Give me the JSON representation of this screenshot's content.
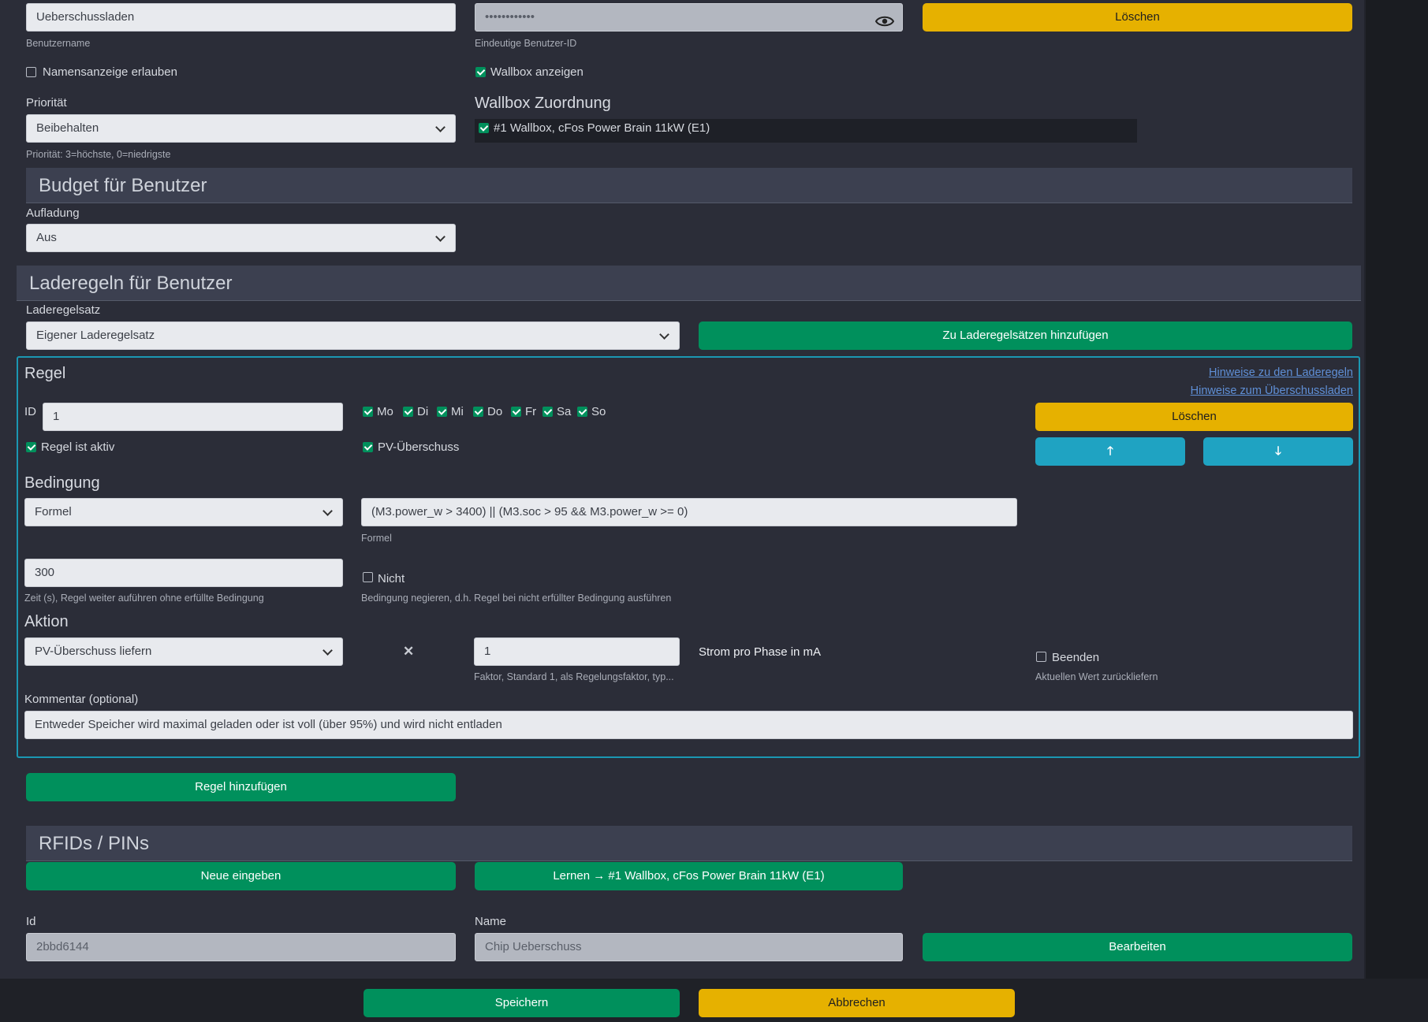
{
  "user": {
    "username_value": "Ueberschussladen",
    "username_caption": "Benutzername",
    "userid_value": "••••••••••••",
    "userid_caption": "Eindeutige Benutzer-ID",
    "delete_label": "Löschen",
    "allow_name_display": {
      "label": "Namensanzeige erlauben",
      "checked": false
    },
    "show_wallbox": {
      "label": "Wallbox anzeigen",
      "checked": true
    },
    "priority_label": "Priorität",
    "priority_value": "Beibehalten",
    "priority_hint": "Priorität: 3=höchste, 0=niedrigste",
    "wallbox_assignment_title": "Wallbox Zuordnung",
    "wallbox_item": {
      "label": "#1 Wallbox, cFos Power Brain 11kW (E1)",
      "checked": true
    }
  },
  "budget": {
    "title": "Budget für Benutzer",
    "charging_label": "Aufladung",
    "charging_value": "Aus"
  },
  "rules": {
    "title": "Laderegeln für Benutzer",
    "ruleset_label": "Laderegelsatz",
    "ruleset_value": "Eigener Laderegelsatz",
    "add_to_rulesets_label": "Zu Laderegelsätzen hinzufügen",
    "rule": {
      "title": "Regel",
      "link_rules_help": "Hinweise zu den Laderegeln",
      "link_surplus_help": "Hinweise zum Überschussladen",
      "id_label": "ID",
      "id_value": "1",
      "days": [
        {
          "label": "Mo",
          "checked": true
        },
        {
          "label": "Di",
          "checked": true
        },
        {
          "label": "Mi",
          "checked": true
        },
        {
          "label": "Do",
          "checked": true
        },
        {
          "label": "Fr",
          "checked": true
        },
        {
          "label": "Sa",
          "checked": true
        },
        {
          "label": "So",
          "checked": true
        }
      ],
      "delete_label": "Löschen",
      "active": {
        "label": "Regel ist aktiv",
        "checked": true
      },
      "pv_surplus": {
        "label": "PV-Überschuss",
        "checked": true
      },
      "condition_title": "Bedingung",
      "condition_type": "Formel",
      "formula_value": "(M3.power_w > 3400) || (M3.soc > 95 && M3.power_w >= 0)",
      "formula_caption": "Formel",
      "time_value": "300",
      "time_caption": "Zeit (s), Regel weiter auführen ohne erfüllte Bedingung",
      "not": {
        "label": "Nicht",
        "checked": false
      },
      "not_caption": "Bedingung negieren, d.h. Regel bei nicht erfüllter Bedingung ausführen",
      "action_title": "Aktion",
      "action_value": "PV-Überschuss liefern",
      "factor_value": "1",
      "factor_caption": "Faktor, Standard 1, als Regelungsfaktor, typ...",
      "current_label": "Strom pro Phase in mA",
      "finish": {
        "label": "Beenden",
        "checked": false
      },
      "finish_caption": "Aktuellen Wert zurückliefern",
      "comment_label": "Kommentar (optional)",
      "comment_value": "Entweder Speicher wird maximal geladen oder ist voll (über 95%) und wird nicht entladen"
    },
    "add_rule_label": "Regel hinzufügen"
  },
  "rfid": {
    "title": "RFIDs / PINs",
    "new_label": "Neue eingeben",
    "learn_label": "Lernen → #1 Wallbox, cFos Power Brain 11kW (E1)",
    "id_label": "Id",
    "id_value": "2bbd6144",
    "name_label": "Name",
    "name_value": "Chip Ueberschuss",
    "edit_label": "Bearbeiten"
  },
  "footer": {
    "save_label": "Speichern",
    "cancel_label": "Abbrechen"
  },
  "colors": {
    "green": "#00905c",
    "yellow": "#e6b100",
    "cyan": "#1fa3c2",
    "panel": "#2b2d38"
  }
}
